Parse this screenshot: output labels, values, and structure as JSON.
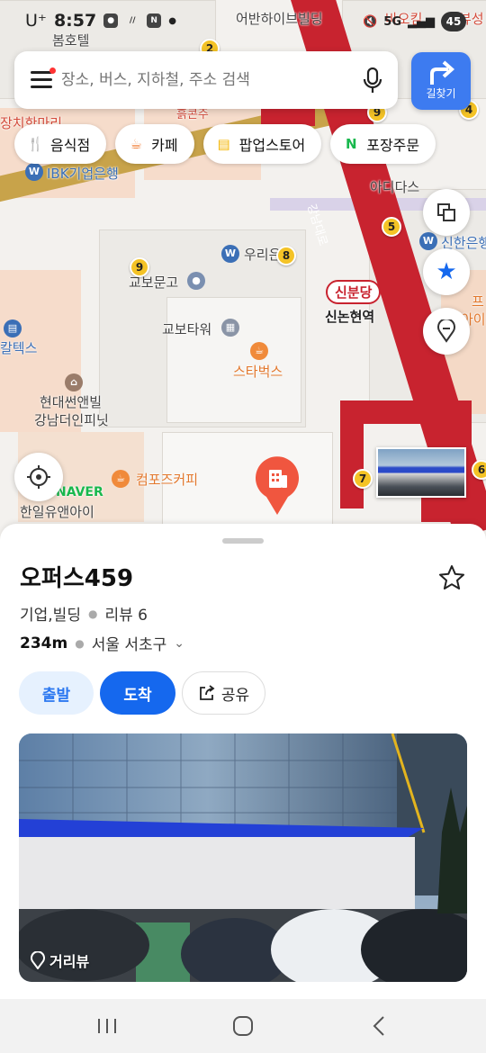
{
  "status_bar": {
    "carrier": "U⁺",
    "time": "8:57",
    "signal": "5G",
    "battery": "45"
  },
  "search": {
    "placeholder": "장소, 버스, 지하철, 주소 검색",
    "route_label": "길찾기"
  },
  "chips": [
    {
      "label": "음식점",
      "icon": "fork-spoon-icon",
      "color": "#f07a2f"
    },
    {
      "label": "카페",
      "icon": "cup-icon",
      "color": "#f07a2f"
    },
    {
      "label": "팝업스토어",
      "icon": "store-icon",
      "color": "#f4b400"
    },
    {
      "label": "포장주문",
      "icon": "naver-n-icon",
      "color": "#18b84d"
    }
  ],
  "map": {
    "labels": {
      "bom_hotel": "봄호텔",
      "urban_hive": "어반하이브빌딩",
      "baekkim": "바오킴",
      "buseong": "뷰성",
      "jangchi": "장치한마리",
      "clinic": "흙콘주",
      "ibk": "IBK기업은행",
      "adidas": "아디다스",
      "shinhan": "신한은행",
      "woori": "우리은행",
      "kyobo_book": "교보문고",
      "kyobo_tower": "교보타워",
      "starbucks": "스타벅스",
      "sinbundang": "신분당",
      "sinnonhyeon": "신논현역",
      "hyundai": "현대썬앤빌",
      "gangnam_the_infinity": "강남더인피닛",
      "compose": "컴포즈커피",
      "naver": "NAVER",
      "hanil": "한일유앤아이",
      "gangnam_daero": "강남대로",
      "galtex": "칼텍스",
      "pr": "프",
      "ai": "아이"
    },
    "exits": [
      "2",
      "9",
      "4",
      "5",
      "9",
      "8",
      "7",
      "6"
    ]
  },
  "place": {
    "title": "오퍼스459",
    "category": "기업,빌딩",
    "reviews": "리뷰 6",
    "distance": "234m",
    "region": "서울 서초구",
    "depart": "출발",
    "arrive": "도착",
    "share": "공유",
    "streetview": "거리뷰"
  },
  "colors": {
    "primary": "#1568ee",
    "subway_line": "#c8232f",
    "pin": "#f0563f"
  }
}
